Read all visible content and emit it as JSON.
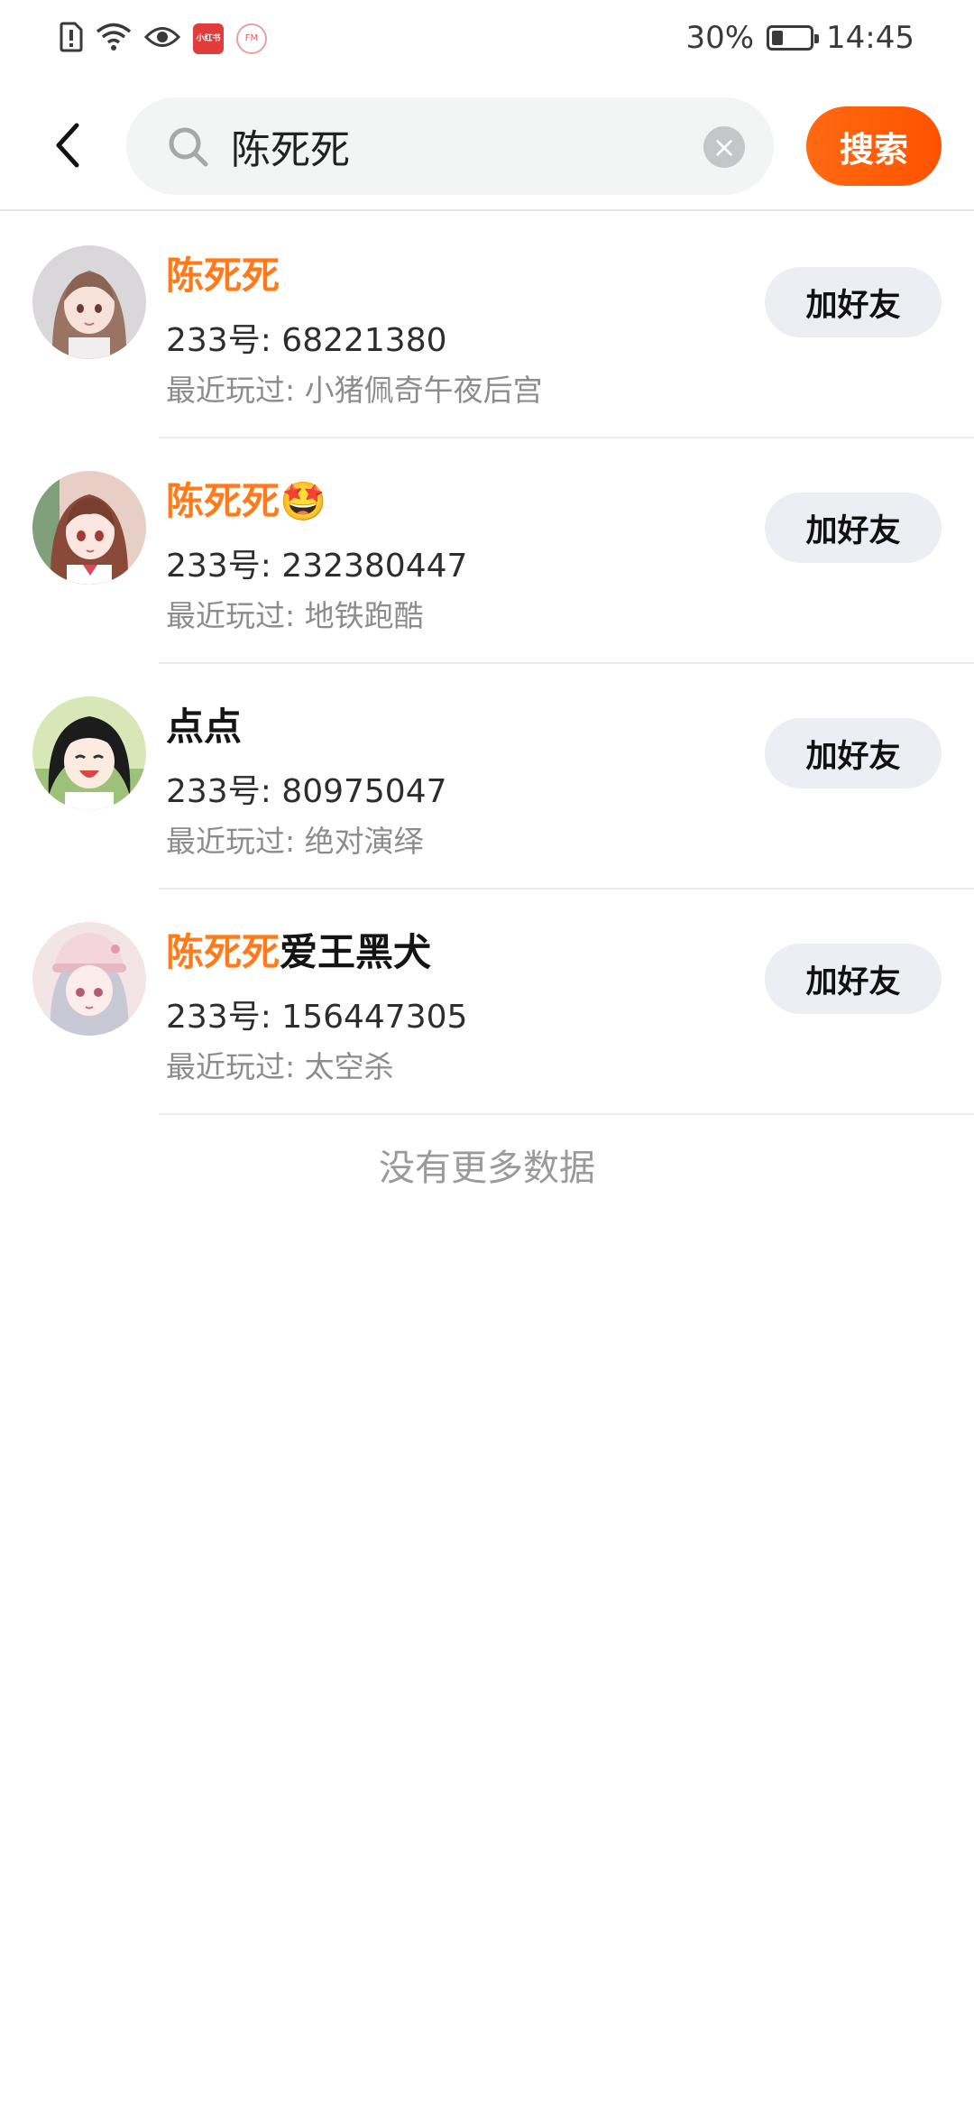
{
  "status_bar": {
    "app_icon_text": "小红书",
    "fm_icon_text": "FM",
    "battery_percent": "30%",
    "battery_level": 0.3,
    "time": "14:45"
  },
  "search": {
    "query": "陈死死",
    "button_label": "搜索"
  },
  "results": [
    {
      "name_highlight": "陈死死",
      "name_rest": "",
      "id_text": "233号: 68221380",
      "recent_text": "最近玩过: 小猪佩奇午夜后宫",
      "add_label": "加好友"
    },
    {
      "name_highlight": "陈死死",
      "name_rest": "🤩",
      "id_text": "233号: 232380447",
      "recent_text": "最近玩过: 地铁跑酷",
      "add_label": "加好友"
    },
    {
      "name_highlight": "",
      "name_rest": "点点",
      "id_text": "233号: 80975047",
      "recent_text": "最近玩过: 绝对演绎",
      "add_label": "加好友"
    },
    {
      "name_highlight": "陈死死",
      "name_rest": "爱王黑犬",
      "id_text": "233号: 156447305",
      "recent_text": "最近玩过: 太空杀",
      "add_label": "加好友"
    }
  ],
  "footer": {
    "no_more_text": "没有更多数据"
  },
  "colors": {
    "accent": "#ff5a0a",
    "highlight": "#ff7a1a",
    "button_bg": "#eceef3"
  }
}
